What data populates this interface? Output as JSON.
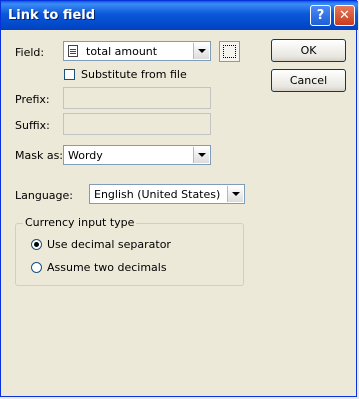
{
  "window": {
    "title": "Link to field",
    "help_label": "?",
    "close_label": "✕"
  },
  "field": {
    "label": "Field:",
    "value": "total amount",
    "icon": "document-icon"
  },
  "substitute": {
    "label": "Substitute from file",
    "checked": false
  },
  "prefix": {
    "label": "Prefix:",
    "value": ""
  },
  "suffix": {
    "label": "Suffix:",
    "value": ""
  },
  "mask": {
    "label": "Mask as:",
    "value": "Wordy"
  },
  "language": {
    "label": "Language:",
    "value": "English (United States)"
  },
  "currency": {
    "legend": "Currency input type",
    "options": [
      {
        "label": "Use decimal separator",
        "selected": true
      },
      {
        "label": "Assume two decimals",
        "selected": false
      }
    ]
  },
  "buttons": {
    "ok": "OK",
    "cancel": "Cancel"
  }
}
